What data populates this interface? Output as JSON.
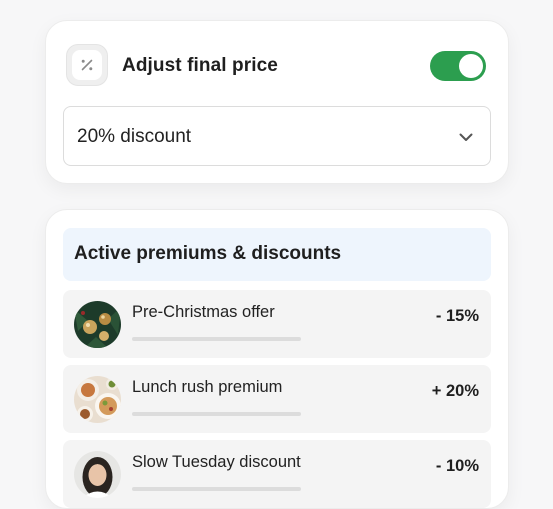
{
  "adjust": {
    "title": "Adjust final price",
    "icon": "percent-icon",
    "toggle_on": true,
    "toggle_color": "#2c9e4f",
    "selected_option": "20% discount"
  },
  "list": {
    "header": "Active premiums & discounts",
    "header_bg": "#eef5fd",
    "items": [
      {
        "label": "Pre-Christmas offer",
        "value": "- 15%",
        "avatar": "christmas-ornaments-photo"
      },
      {
        "label": "Lunch rush premium",
        "value": "+ 20%",
        "avatar": "food-dishes-photo"
      },
      {
        "label": "Slow Tuesday discount",
        "value": "- 10%",
        "avatar": "person-portrait-photo"
      }
    ]
  }
}
